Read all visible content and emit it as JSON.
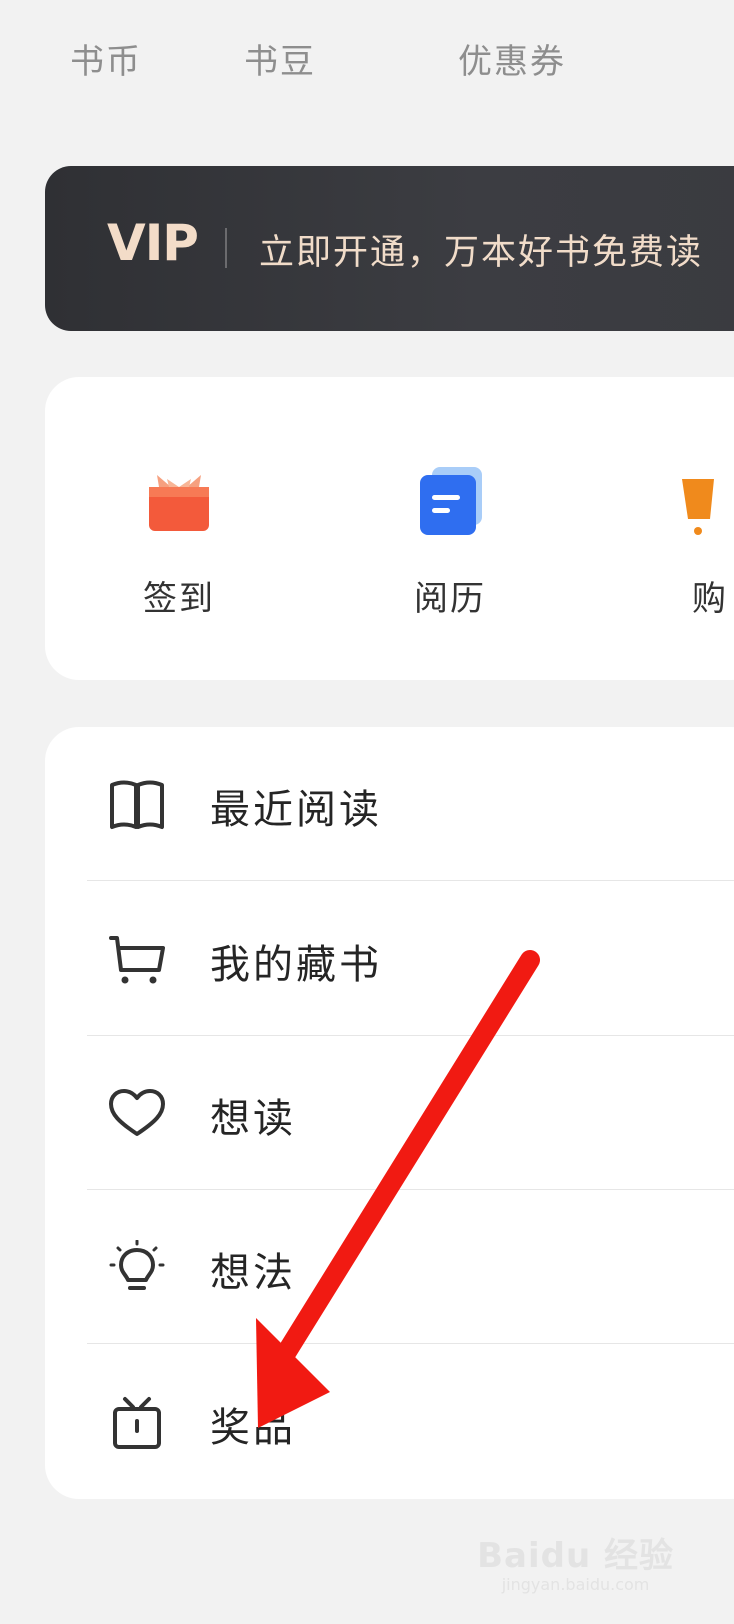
{
  "top_tabs": [
    "书币",
    "书豆",
    "优惠券"
  ],
  "vip": {
    "logo": "VIP",
    "promo": "立即开通，万本好书免费读"
  },
  "quick_actions": [
    {
      "label": "签到",
      "icon": "gift-icon",
      "color": "#f2553a"
    },
    {
      "label": "阅历",
      "icon": "reading-history-icon",
      "color": "#2f6ef0"
    },
    {
      "label": "购",
      "icon": "shopping-bag-icon",
      "color": "#f08a1c"
    }
  ],
  "menu": [
    {
      "label": "最近阅读",
      "icon": "open-book-icon"
    },
    {
      "label": "我的藏书",
      "icon": "cart-icon"
    },
    {
      "label": "想读",
      "icon": "heart-icon"
    },
    {
      "label": "想法",
      "icon": "lightbulb-icon"
    },
    {
      "label": "奖品",
      "icon": "prize-box-icon"
    }
  ],
  "annotation": {
    "color": "#f11a12"
  },
  "watermark": {
    "main": "Baidu 经验",
    "sub": "jingyan.baidu.com"
  }
}
